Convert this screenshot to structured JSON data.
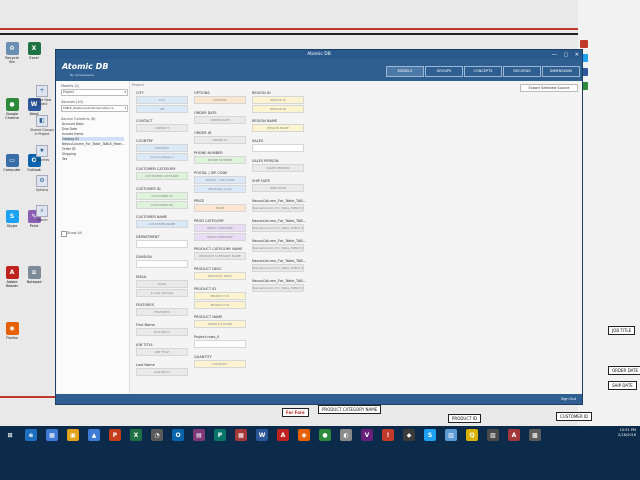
{
  "desktop": {
    "icons": [
      {
        "label": "Recycle Bin",
        "color": "#6b8fb3",
        "glyph": "♻"
      },
      {
        "label": "Google Chrome",
        "color": "#2c8a3a",
        "glyph": "●"
      },
      {
        "label": "Computer",
        "color": "#3a6ea8",
        "glyph": "▭"
      },
      {
        "label": "Skype",
        "color": "#1da1f2",
        "glyph": "S"
      },
      {
        "label": "Adobe Reader",
        "color": "#c0231f",
        "glyph": "A"
      },
      {
        "label": "Firefox",
        "color": "#e66000",
        "glyph": "◉"
      },
      {
        "label": "Excel",
        "color": "#1f7244",
        "glyph": "X"
      },
      {
        "label": "Word",
        "color": "#2b579a",
        "glyph": "W"
      },
      {
        "label": "Outlook",
        "color": "#0a64ad",
        "glyph": "O"
      },
      {
        "label": "Paint",
        "color": "#8a5fb3",
        "glyph": "✎"
      },
      {
        "label": "Notepad",
        "color": "#7e8c99",
        "glyph": "≡"
      }
    ],
    "right_icons": [
      {
        "color": "#c0392b"
      },
      {
        "color": "#1da1f2"
      },
      {
        "color": "#2b579a"
      },
      {
        "color": "#2c8a3a"
      }
    ],
    "diagram_labels": [
      "JOB TITLE",
      "ORDER DATE",
      "SHIP DATE",
      "CUSTOMER ID",
      "PRODUCT ID",
      "PRODUCT CATEGORY NAME",
      "For Fore"
    ]
  },
  "window": {
    "title": "Atomic DB",
    "logo": "Atomic DB",
    "logo_sub": "By Xpressoware",
    "controls": {
      "minimize": "—",
      "maximize": "▢",
      "close": "✕"
    },
    "nav": [
      "MODELS",
      "GROUPS",
      "CONCEPTS",
      "RECORDS",
      "DIMENSIONS"
    ],
    "active_nav": 0,
    "export_label": "Export Selected Source",
    "project_label": "Project"
  },
  "left": {
    "models_label": "Models (1)",
    "models_value": "Project",
    "sources_label": "Sources (10)",
    "sources_value": "TABLE_RelationalizedSchemaSource",
    "group_label": "Source Columns (8)",
    "tree": [
      "Account Data",
      "Due Date",
      "Invoice Items",
      "Catalog ID",
      "NexusColumn_For_Table_TABLE_Relat...",
      "Order ID",
      "Shipping",
      "Tax"
    ],
    "checkbox_label": "Show All"
  },
  "sidebar": [
    {
      "label": "Create New Project",
      "glyph": "+"
    },
    {
      "label": "Shared Groups in Project",
      "glyph": "◧"
    },
    {
      "label": "Favorites",
      "glyph": "★"
    },
    {
      "label": "Options",
      "glyph": "⚙"
    },
    {
      "label": "Search",
      "glyph": "⌕"
    }
  ],
  "fields": [
    {
      "label": "CITY",
      "values": [
        "CITY",
        "CIE"
      ],
      "color": "c-blue"
    },
    {
      "label": "CONTACT",
      "values": [
        "CONTACT"
      ],
      "color": "c-gray"
    },
    {
      "label": "COUNTRY",
      "values": [
        "COUNTRY",
        "Country/Region"
      ],
      "color": "c-blue"
    },
    {
      "label": "CUSTOMER CATEGORY",
      "values": [
        "CUSTOMER CATEGORY"
      ],
      "color": "c-green"
    },
    {
      "label": "CUSTOMER ID",
      "values": [
        "CUSTOMER ID",
        "CUSTOMER NO"
      ],
      "color": "c-green"
    },
    {
      "label": "CUSTOMER NAME",
      "values": [
        "CUSTOMER NAME"
      ],
      "color": "c-blue"
    },
    {
      "label": "DEPARTMENT",
      "values": [
        ""
      ],
      "color": "c-none"
    },
    {
      "label": "DIVISION",
      "values": [
        ""
      ],
      "color": "c-none"
    },
    {
      "label": "EMAIL",
      "values": [
        "Email",
        "E-mail Address"
      ],
      "color": "c-gray"
    },
    {
      "label": "FEATURES",
      "values": [
        "FEATURES"
      ],
      "color": "c-gray"
    },
    {
      "label": "First Name",
      "values": [
        "First Name"
      ],
      "color": "c-gray"
    },
    {
      "label": "JOB TITLE",
      "values": [
        "JOB TITLE"
      ],
      "color": "c-gray"
    },
    {
      "label": "Last Name",
      "values": [
        "Last Name"
      ],
      "color": "c-gray"
    },
    {
      "label": "OPTIONS",
      "values": [
        "OPTIONS"
      ],
      "color": "c-orange"
    },
    {
      "label": "ORDER DATE",
      "values": [
        "ORDER DATE"
      ],
      "color": "c-gray"
    },
    {
      "label": "ORDER ID",
      "values": [
        "ORDER ID"
      ],
      "color": "c-gray"
    },
    {
      "label": "PHONE NUMBER",
      "values": [
        "PHONE NUMBER"
      ],
      "color": "c-green"
    },
    {
      "label": "POSTAL / ZIP CODE",
      "values": [
        "POSTAL / ZIP CODE",
        "ZIP/Postal Code"
      ],
      "color": "c-blue"
    },
    {
      "label": "PRICE",
      "values": [
        "PRICE"
      ],
      "color": "c-orange"
    },
    {
      "label": "PROD CATEGORY",
      "values": [
        "PROD CATEGORY",
        "PROD CATEGORY"
      ],
      "color": "c-purple"
    },
    {
      "label": "PRODUCT CATEGORY NAME",
      "values": [
        "PRODUCT CATEGORY NAME"
      ],
      "color": "c-gray"
    },
    {
      "label": "PRODUCT DESC",
      "values": [
        "PRODUCT DESC"
      ],
      "color": "c-yellow"
    },
    {
      "label": "PRODUCT ID",
      "values": [
        "PRODUCT ID",
        "PRODUCT ID"
      ],
      "color": "c-yellow"
    },
    {
      "label": "PRODUCT NAME",
      "values": [
        "PRODUCT NAME"
      ],
      "color": "c-yellow"
    },
    {
      "label": "Project.rows_0",
      "values": [
        ""
      ],
      "color": "c-none"
    },
    {
      "label": "QUANTITY",
      "values": [
        "QUANTITY"
      ],
      "color": "c-yellow"
    },
    {
      "label": "REGION ID",
      "values": [
        "REGION ID",
        "REGION ID"
      ],
      "color": "c-yellow"
    },
    {
      "label": "REGION NAME",
      "values": [
        "REGION NAME"
      ],
      "color": "c-yellow"
    },
    {
      "label": "SALES",
      "values": [
        ""
      ],
      "color": "c-none"
    },
    {
      "label": "SALES PERSON",
      "values": [
        "SALES PERSON"
      ],
      "color": "c-gray"
    },
    {
      "label": "SHIP DATE",
      "values": [
        "SHIP DATE"
      ],
      "color": "c-gray"
    },
    {
      "label": "NexusColumn_For_Table_TAB...",
      "values": [
        "NexusColumn_For_Table_TABLE_R..."
      ],
      "color": "c-gray"
    },
    {
      "label": "NexusColumn_For_Table_TAB...",
      "values": [
        "NexusColumn_For_Table_TABLE_R..."
      ],
      "color": "c-gray"
    },
    {
      "label": "NexusColumn_For_Table_TAB...",
      "values": [
        "NexusColumn_For_Table_TABLE_R..."
      ],
      "color": "c-gray"
    },
    {
      "label": "NexusColumn_For_Table_TAB...",
      "values": [
        "NexusColumn_For_Table_TABLE_R..."
      ],
      "color": "c-gray"
    },
    {
      "label": "NexusColumn_For_Table_TAB...",
      "values": [
        "NexusColumn_For_Table_TABLE_R..."
      ],
      "color": "c-gray"
    }
  ],
  "statusbar": {
    "right": "Sign Out"
  },
  "taskbar": {
    "apps": [
      {
        "glyph": "⊞",
        "color": "#0c2a4a"
      },
      {
        "glyph": "e",
        "color": "#1e6fc0"
      },
      {
        "glyph": "▦",
        "color": "#3d7bd6"
      },
      {
        "glyph": "▣",
        "color": "#e3a21a"
      },
      {
        "glyph": "▲",
        "color": "#3d7bd6"
      },
      {
        "glyph": "P",
        "color": "#c43e1c"
      },
      {
        "glyph": "X",
        "color": "#1f7244"
      },
      {
        "glyph": "◔",
        "color": "#5a5a5a"
      },
      {
        "glyph": "O",
        "color": "#0a64ad"
      },
      {
        "glyph": "▤",
        "color": "#7e3878"
      },
      {
        "glyph": "P",
        "color": "#077568"
      },
      {
        "glyph": "▦",
        "color": "#a4373a"
      },
      {
        "glyph": "W",
        "color": "#2b579a"
      },
      {
        "glyph": "A",
        "color": "#c0231f"
      },
      {
        "glyph": "◉",
        "color": "#e66000"
      },
      {
        "glyph": "●",
        "color": "#2c8a3a"
      },
      {
        "glyph": "◐",
        "color": "#8a8a8a"
      },
      {
        "glyph": "V",
        "color": "#68217a"
      },
      {
        "glyph": "!",
        "color": "#c0392b"
      },
      {
        "glyph": "◆",
        "color": "#3b3b3b"
      },
      {
        "glyph": "S",
        "color": "#1da1f2"
      },
      {
        "glyph": "▥",
        "color": "#5b9bd5"
      },
      {
        "glyph": "Q",
        "color": "#dcb200"
      },
      {
        "glyph": "▧",
        "color": "#4a4a4a"
      },
      {
        "glyph": "A",
        "color": "#a4373a"
      },
      {
        "glyph": "▩",
        "color": "#5b5b5b"
      }
    ],
    "time": "10:51 PM",
    "date": "2/16/2016"
  }
}
